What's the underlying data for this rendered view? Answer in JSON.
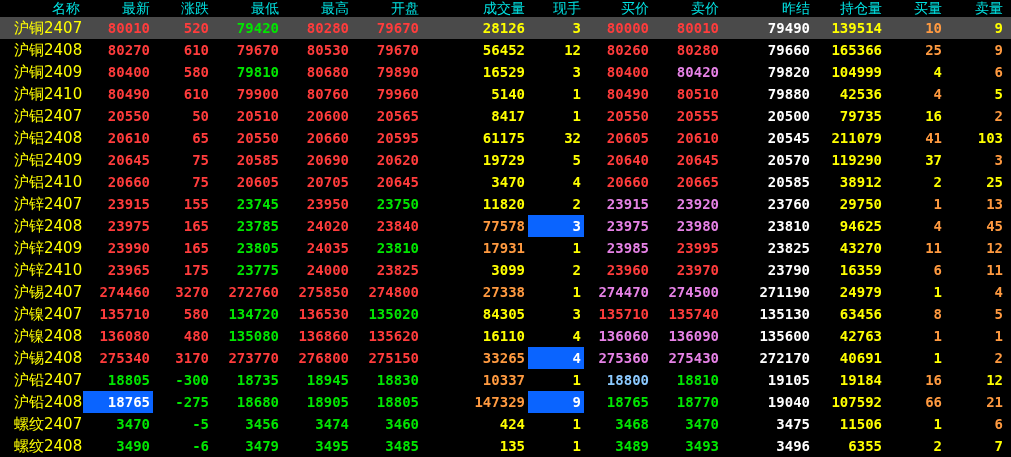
{
  "columns": [
    "名称",
    "最新",
    "涨跌",
    "最低",
    "最高",
    "开盘",
    "成交量",
    "现手",
    "买价",
    "卖价",
    "昨结",
    "持仓量",
    "买量",
    "卖量"
  ],
  "rows": [
    {
      "name": "沪铜2407",
      "selected": true,
      "cells": [
        {
          "text": "80010",
          "color": "#ff3c3c",
          "highlighted": false
        },
        {
          "text": "520",
          "color": "#ff3c3c",
          "highlighted": false
        },
        {
          "text": "79420",
          "color": "#00e600",
          "highlighted": false
        },
        {
          "text": "80280",
          "color": "#ff3c3c",
          "highlighted": false
        },
        {
          "text": "79670",
          "color": "#ff3c3c",
          "highlighted": false
        },
        {
          "text": "28126",
          "color": "#ffff00",
          "highlighted": false
        },
        {
          "text": "3",
          "color": "#ffff00",
          "highlighted": false
        },
        {
          "text": "80000",
          "color": "#ff3c3c",
          "highlighted": false
        },
        {
          "text": "80010",
          "color": "#ff3c3c",
          "highlighted": false
        },
        {
          "text": "79490",
          "color": "#ffffff",
          "highlighted": false
        },
        {
          "text": "139514",
          "color": "#ffff00",
          "highlighted": false
        },
        {
          "text": "10",
          "color": "#ff9a40",
          "highlighted": false
        },
        {
          "text": "9",
          "color": "#ffff00",
          "highlighted": false
        }
      ]
    },
    {
      "name": "沪铜2408",
      "selected": false,
      "cells": [
        {
          "text": "80270",
          "color": "#ff3c3c",
          "highlighted": false
        },
        {
          "text": "610",
          "color": "#ff3c3c",
          "highlighted": false
        },
        {
          "text": "79670",
          "color": "#ff3c3c",
          "highlighted": false
        },
        {
          "text": "80530",
          "color": "#ff3c3c",
          "highlighted": false
        },
        {
          "text": "79670",
          "color": "#ff3c3c",
          "highlighted": false
        },
        {
          "text": "56452",
          "color": "#ffff00",
          "highlighted": false
        },
        {
          "text": "12",
          "color": "#ffff00",
          "highlighted": false
        },
        {
          "text": "80260",
          "color": "#ff3c3c",
          "highlighted": false
        },
        {
          "text": "80280",
          "color": "#ff3c3c",
          "highlighted": false
        },
        {
          "text": "79660",
          "color": "#ffffff",
          "highlighted": false
        },
        {
          "text": "165366",
          "color": "#ffff00",
          "highlighted": false
        },
        {
          "text": "25",
          "color": "#ff9a40",
          "highlighted": false
        },
        {
          "text": "9",
          "color": "#ff9a40",
          "highlighted": false
        }
      ]
    },
    {
      "name": "沪铜2409",
      "selected": false,
      "cells": [
        {
          "text": "80400",
          "color": "#ff3c3c",
          "highlighted": false
        },
        {
          "text": "580",
          "color": "#ff3c3c",
          "highlighted": false
        },
        {
          "text": "79810",
          "color": "#00e600",
          "highlighted": false
        },
        {
          "text": "80680",
          "color": "#ff3c3c",
          "highlighted": false
        },
        {
          "text": "79890",
          "color": "#ff3c3c",
          "highlighted": false
        },
        {
          "text": "16529",
          "color": "#ffff00",
          "highlighted": false
        },
        {
          "text": "3",
          "color": "#ffff00",
          "highlighted": false
        },
        {
          "text": "80400",
          "color": "#ff3c3c",
          "highlighted": false
        },
        {
          "text": "80420",
          "color": "#e682e6",
          "highlighted": false
        },
        {
          "text": "79820",
          "color": "#ffffff",
          "highlighted": false
        },
        {
          "text": "104999",
          "color": "#ffff00",
          "highlighted": false
        },
        {
          "text": "4",
          "color": "#ffff00",
          "highlighted": false
        },
        {
          "text": "6",
          "color": "#ff9a40",
          "highlighted": false
        }
      ]
    },
    {
      "name": "沪铜2410",
      "selected": false,
      "cells": [
        {
          "text": "80490",
          "color": "#ff3c3c",
          "highlighted": false
        },
        {
          "text": "610",
          "color": "#ff3c3c",
          "highlighted": false
        },
        {
          "text": "79900",
          "color": "#ff3c3c",
          "highlighted": false
        },
        {
          "text": "80760",
          "color": "#ff3c3c",
          "highlighted": false
        },
        {
          "text": "79960",
          "color": "#ff3c3c",
          "highlighted": false
        },
        {
          "text": "5140",
          "color": "#ffff00",
          "highlighted": false
        },
        {
          "text": "1",
          "color": "#ffff00",
          "highlighted": false
        },
        {
          "text": "80490",
          "color": "#ff3c3c",
          "highlighted": false
        },
        {
          "text": "80510",
          "color": "#ff3c3c",
          "highlighted": false
        },
        {
          "text": "79880",
          "color": "#ffffff",
          "highlighted": false
        },
        {
          "text": "42536",
          "color": "#ffff00",
          "highlighted": false
        },
        {
          "text": "4",
          "color": "#ff9a40",
          "highlighted": false
        },
        {
          "text": "5",
          "color": "#ffff00",
          "highlighted": false
        }
      ]
    },
    {
      "name": "沪铝2407",
      "selected": false,
      "cells": [
        {
          "text": "20550",
          "color": "#ff3c3c",
          "highlighted": false
        },
        {
          "text": "50",
          "color": "#ff3c3c",
          "highlighted": false
        },
        {
          "text": "20510",
          "color": "#ff3c3c",
          "highlighted": false
        },
        {
          "text": "20600",
          "color": "#ff3c3c",
          "highlighted": false
        },
        {
          "text": "20565",
          "color": "#ff3c3c",
          "highlighted": false
        },
        {
          "text": "8417",
          "color": "#ffff00",
          "highlighted": false
        },
        {
          "text": "1",
          "color": "#ffff00",
          "highlighted": false
        },
        {
          "text": "20550",
          "color": "#ff3c3c",
          "highlighted": false
        },
        {
          "text": "20555",
          "color": "#ff3c3c",
          "highlighted": false
        },
        {
          "text": "20500",
          "color": "#ffffff",
          "highlighted": false
        },
        {
          "text": "79735",
          "color": "#ffff00",
          "highlighted": false
        },
        {
          "text": "16",
          "color": "#ffff00",
          "highlighted": false
        },
        {
          "text": "2",
          "color": "#ff9a40",
          "highlighted": false
        }
      ]
    },
    {
      "name": "沪铝2408",
      "selected": false,
      "cells": [
        {
          "text": "20610",
          "color": "#ff3c3c",
          "highlighted": false
        },
        {
          "text": "65",
          "color": "#ff3c3c",
          "highlighted": false
        },
        {
          "text": "20550",
          "color": "#ff3c3c",
          "highlighted": false
        },
        {
          "text": "20660",
          "color": "#ff3c3c",
          "highlighted": false
        },
        {
          "text": "20595",
          "color": "#ff3c3c",
          "highlighted": false
        },
        {
          "text": "61175",
          "color": "#ffff00",
          "highlighted": false
        },
        {
          "text": "32",
          "color": "#ffff00",
          "highlighted": false
        },
        {
          "text": "20605",
          "color": "#ff3c3c",
          "highlighted": false
        },
        {
          "text": "20610",
          "color": "#ff3c3c",
          "highlighted": false
        },
        {
          "text": "20545",
          "color": "#ffffff",
          "highlighted": false
        },
        {
          "text": "211079",
          "color": "#ffff00",
          "highlighted": false
        },
        {
          "text": "41",
          "color": "#ff9a40",
          "highlighted": false
        },
        {
          "text": "103",
          "color": "#ffff00",
          "highlighted": false
        }
      ]
    },
    {
      "name": "沪铝2409",
      "selected": false,
      "cells": [
        {
          "text": "20645",
          "color": "#ff3c3c",
          "highlighted": false
        },
        {
          "text": "75",
          "color": "#ff3c3c",
          "highlighted": false
        },
        {
          "text": "20585",
          "color": "#ff3c3c",
          "highlighted": false
        },
        {
          "text": "20690",
          "color": "#ff3c3c",
          "highlighted": false
        },
        {
          "text": "20620",
          "color": "#ff3c3c",
          "highlighted": false
        },
        {
          "text": "19729",
          "color": "#ffff00",
          "highlighted": false
        },
        {
          "text": "5",
          "color": "#ffff00",
          "highlighted": false
        },
        {
          "text": "20640",
          "color": "#ff3c3c",
          "highlighted": false
        },
        {
          "text": "20645",
          "color": "#ff3c3c",
          "highlighted": false
        },
        {
          "text": "20570",
          "color": "#ffffff",
          "highlighted": false
        },
        {
          "text": "119290",
          "color": "#ffff00",
          "highlighted": false
        },
        {
          "text": "37",
          "color": "#ffff00",
          "highlighted": false
        },
        {
          "text": "3",
          "color": "#ff9a40",
          "highlighted": false
        }
      ]
    },
    {
      "name": "沪铝2410",
      "selected": false,
      "cells": [
        {
          "text": "20660",
          "color": "#ff3c3c",
          "highlighted": false
        },
        {
          "text": "75",
          "color": "#ff3c3c",
          "highlighted": false
        },
        {
          "text": "20605",
          "color": "#ff3c3c",
          "highlighted": false
        },
        {
          "text": "20705",
          "color": "#ff3c3c",
          "highlighted": false
        },
        {
          "text": "20645",
          "color": "#ff3c3c",
          "highlighted": false
        },
        {
          "text": "3470",
          "color": "#ffff00",
          "highlighted": false
        },
        {
          "text": "4",
          "color": "#ffff00",
          "highlighted": false
        },
        {
          "text": "20660",
          "color": "#ff3c3c",
          "highlighted": false
        },
        {
          "text": "20665",
          "color": "#ff3c3c",
          "highlighted": false
        },
        {
          "text": "20585",
          "color": "#ffffff",
          "highlighted": false
        },
        {
          "text": "38912",
          "color": "#ffff00",
          "highlighted": false
        },
        {
          "text": "2",
          "color": "#ffff00",
          "highlighted": false
        },
        {
          "text": "25",
          "color": "#ffff00",
          "highlighted": false
        }
      ]
    },
    {
      "name": "沪锌2407",
      "selected": false,
      "cells": [
        {
          "text": "23915",
          "color": "#ff3c3c",
          "highlighted": false
        },
        {
          "text": "155",
          "color": "#ff3c3c",
          "highlighted": false
        },
        {
          "text": "23745",
          "color": "#00e600",
          "highlighted": false
        },
        {
          "text": "23950",
          "color": "#ff3c3c",
          "highlighted": false
        },
        {
          "text": "23750",
          "color": "#00e600",
          "highlighted": false
        },
        {
          "text": "11820",
          "color": "#ffff00",
          "highlighted": false
        },
        {
          "text": "2",
          "color": "#ffff00",
          "highlighted": false
        },
        {
          "text": "23915",
          "color": "#e682e6",
          "highlighted": false
        },
        {
          "text": "23920",
          "color": "#e682e6",
          "highlighted": false
        },
        {
          "text": "23760",
          "color": "#ffffff",
          "highlighted": false
        },
        {
          "text": "29750",
          "color": "#ffff00",
          "highlighted": false
        },
        {
          "text": "1",
          "color": "#ff9a40",
          "highlighted": false
        },
        {
          "text": "13",
          "color": "#ff9a40",
          "highlighted": false
        }
      ]
    },
    {
      "name": "沪锌2408",
      "selected": false,
      "cells": [
        {
          "text": "23975",
          "color": "#ff3c3c",
          "highlighted": false
        },
        {
          "text": "165",
          "color": "#ff3c3c",
          "highlighted": false
        },
        {
          "text": "23785",
          "color": "#00e600",
          "highlighted": false
        },
        {
          "text": "24020",
          "color": "#ff3c3c",
          "highlighted": false
        },
        {
          "text": "23840",
          "color": "#ff3c3c",
          "highlighted": false
        },
        {
          "text": "77578",
          "color": "#ff9a40",
          "highlighted": false
        },
        {
          "text": "3",
          "color": "#ffffff",
          "highlighted": true
        },
        {
          "text": "23975",
          "color": "#e682e6",
          "highlighted": false
        },
        {
          "text": "23980",
          "color": "#e682e6",
          "highlighted": false
        },
        {
          "text": "23810",
          "color": "#ffffff",
          "highlighted": false
        },
        {
          "text": "94625",
          "color": "#ffff00",
          "highlighted": false
        },
        {
          "text": "4",
          "color": "#ff9a40",
          "highlighted": false
        },
        {
          "text": "45",
          "color": "#ff9a40",
          "highlighted": false
        }
      ]
    },
    {
      "name": "沪锌2409",
      "selected": false,
      "cells": [
        {
          "text": "23990",
          "color": "#ff3c3c",
          "highlighted": false
        },
        {
          "text": "165",
          "color": "#ff3c3c",
          "highlighted": false
        },
        {
          "text": "23805",
          "color": "#00e600",
          "highlighted": false
        },
        {
          "text": "24035",
          "color": "#ff3c3c",
          "highlighted": false
        },
        {
          "text": "23810",
          "color": "#00e600",
          "highlighted": false
        },
        {
          "text": "17931",
          "color": "#ff9a40",
          "highlighted": false
        },
        {
          "text": "1",
          "color": "#ffff00",
          "highlighted": false
        },
        {
          "text": "23985",
          "color": "#e682e6",
          "highlighted": false
        },
        {
          "text": "23995",
          "color": "#ff3c3c",
          "highlighted": false
        },
        {
          "text": "23825",
          "color": "#ffffff",
          "highlighted": false
        },
        {
          "text": "43270",
          "color": "#ffff00",
          "highlighted": false
        },
        {
          "text": "11",
          "color": "#ff9a40",
          "highlighted": false
        },
        {
          "text": "12",
          "color": "#ff9a40",
          "highlighted": false
        }
      ]
    },
    {
      "name": "沪锌2410",
      "selected": false,
      "cells": [
        {
          "text": "23965",
          "color": "#ff3c3c",
          "highlighted": false
        },
        {
          "text": "175",
          "color": "#ff3c3c",
          "highlighted": false
        },
        {
          "text": "23775",
          "color": "#00e600",
          "highlighted": false
        },
        {
          "text": "24000",
          "color": "#ff3c3c",
          "highlighted": false
        },
        {
          "text": "23825",
          "color": "#ff3c3c",
          "highlighted": false
        },
        {
          "text": "3099",
          "color": "#ffff00",
          "highlighted": false
        },
        {
          "text": "2",
          "color": "#ffff00",
          "highlighted": false
        },
        {
          "text": "23960",
          "color": "#ff3c3c",
          "highlighted": false
        },
        {
          "text": "23970",
          "color": "#ff3c3c",
          "highlighted": false
        },
        {
          "text": "23790",
          "color": "#ffffff",
          "highlighted": false
        },
        {
          "text": "16359",
          "color": "#ffff00",
          "highlighted": false
        },
        {
          "text": "6",
          "color": "#ff9a40",
          "highlighted": false
        },
        {
          "text": "11",
          "color": "#ff9a40",
          "highlighted": false
        }
      ]
    },
    {
      "name": "沪锡2407",
      "selected": false,
      "cells": [
        {
          "text": "274460",
          "color": "#ff3c3c",
          "highlighted": false
        },
        {
          "text": "3270",
          "color": "#ff3c3c",
          "highlighted": false
        },
        {
          "text": "272760",
          "color": "#ff3c3c",
          "highlighted": false
        },
        {
          "text": "275850",
          "color": "#ff3c3c",
          "highlighted": false
        },
        {
          "text": "274800",
          "color": "#ff3c3c",
          "highlighted": false
        },
        {
          "text": "27338",
          "color": "#ff9a40",
          "highlighted": false
        },
        {
          "text": "1",
          "color": "#ffff00",
          "highlighted": false
        },
        {
          "text": "274470",
          "color": "#e682e6",
          "highlighted": false
        },
        {
          "text": "274500",
          "color": "#e682e6",
          "highlighted": false
        },
        {
          "text": "271190",
          "color": "#ffffff",
          "highlighted": false
        },
        {
          "text": "24979",
          "color": "#ffff00",
          "highlighted": false
        },
        {
          "text": "1",
          "color": "#ffff00",
          "highlighted": false
        },
        {
          "text": "4",
          "color": "#ff9a40",
          "highlighted": false
        }
      ]
    },
    {
      "name": "沪镍2407",
      "selected": false,
      "cells": [
        {
          "text": "135710",
          "color": "#ff3c3c",
          "highlighted": false
        },
        {
          "text": "580",
          "color": "#ff3c3c",
          "highlighted": false
        },
        {
          "text": "134720",
          "color": "#00e600",
          "highlighted": false
        },
        {
          "text": "136530",
          "color": "#ff3c3c",
          "highlighted": false
        },
        {
          "text": "135020",
          "color": "#00e600",
          "highlighted": false
        },
        {
          "text": "84305",
          "color": "#ffff00",
          "highlighted": false
        },
        {
          "text": "3",
          "color": "#ffff00",
          "highlighted": false
        },
        {
          "text": "135710",
          "color": "#ff3c3c",
          "highlighted": false
        },
        {
          "text": "135740",
          "color": "#ff3c3c",
          "highlighted": false
        },
        {
          "text": "135130",
          "color": "#ffffff",
          "highlighted": false
        },
        {
          "text": "63456",
          "color": "#ffff00",
          "highlighted": false
        },
        {
          "text": "8",
          "color": "#ff9a40",
          "highlighted": false
        },
        {
          "text": "5",
          "color": "#ff9a40",
          "highlighted": false
        }
      ]
    },
    {
      "name": "沪镍2408",
      "selected": false,
      "cells": [
        {
          "text": "136080",
          "color": "#ff3c3c",
          "highlighted": false
        },
        {
          "text": "480",
          "color": "#ff3c3c",
          "highlighted": false
        },
        {
          "text": "135080",
          "color": "#00e600",
          "highlighted": false
        },
        {
          "text": "136860",
          "color": "#ff3c3c",
          "highlighted": false
        },
        {
          "text": "135620",
          "color": "#ff3c3c",
          "highlighted": false
        },
        {
          "text": "16110",
          "color": "#ffff00",
          "highlighted": false
        },
        {
          "text": "4",
          "color": "#ffff00",
          "highlighted": false
        },
        {
          "text": "136060",
          "color": "#e682e6",
          "highlighted": false
        },
        {
          "text": "136090",
          "color": "#e682e6",
          "highlighted": false
        },
        {
          "text": "135600",
          "color": "#ffffff",
          "highlighted": false
        },
        {
          "text": "42763",
          "color": "#ffff00",
          "highlighted": false
        },
        {
          "text": "1",
          "color": "#ff9a40",
          "highlighted": false
        },
        {
          "text": "1",
          "color": "#ff9a40",
          "highlighted": false
        }
      ]
    },
    {
      "name": "沪锡2408",
      "selected": false,
      "cells": [
        {
          "text": "275340",
          "color": "#ff3c3c",
          "highlighted": false
        },
        {
          "text": "3170",
          "color": "#ff3c3c",
          "highlighted": false
        },
        {
          "text": "273770",
          "color": "#ff3c3c",
          "highlighted": false
        },
        {
          "text": "276800",
          "color": "#ff3c3c",
          "highlighted": false
        },
        {
          "text": "275150",
          "color": "#ff3c3c",
          "highlighted": false
        },
        {
          "text": "33265",
          "color": "#ff9a40",
          "highlighted": false
        },
        {
          "text": "4",
          "color": "#ffffff",
          "highlighted": true
        },
        {
          "text": "275360",
          "color": "#e682e6",
          "highlighted": false
        },
        {
          "text": "275430",
          "color": "#e682e6",
          "highlighted": false
        },
        {
          "text": "272170",
          "color": "#ffffff",
          "highlighted": false
        },
        {
          "text": "40691",
          "color": "#ffff00",
          "highlighted": false
        },
        {
          "text": "1",
          "color": "#ffff00",
          "highlighted": false
        },
        {
          "text": "2",
          "color": "#ff9a40",
          "highlighted": false
        }
      ]
    },
    {
      "name": "沪铅2407",
      "selected": false,
      "cells": [
        {
          "text": "18805",
          "color": "#00e600",
          "highlighted": false
        },
        {
          "text": "-300",
          "color": "#00e600",
          "highlighted": false
        },
        {
          "text": "18735",
          "color": "#00e600",
          "highlighted": false
        },
        {
          "text": "18945",
          "color": "#00e600",
          "highlighted": false
        },
        {
          "text": "18830",
          "color": "#00e600",
          "highlighted": false
        },
        {
          "text": "10337",
          "color": "#ff9a40",
          "highlighted": false
        },
        {
          "text": "1",
          "color": "#ffff00",
          "highlighted": false
        },
        {
          "text": "18800",
          "color": "#8ccaff",
          "highlighted": false
        },
        {
          "text": "18810",
          "color": "#00e600",
          "highlighted": false
        },
        {
          "text": "19105",
          "color": "#ffffff",
          "highlighted": false
        },
        {
          "text": "19184",
          "color": "#ffff00",
          "highlighted": false
        },
        {
          "text": "16",
          "color": "#ff9a40",
          "highlighted": false
        },
        {
          "text": "12",
          "color": "#ffff00",
          "highlighted": false
        }
      ]
    },
    {
      "name": "沪铅2408",
      "selected": false,
      "cells": [
        {
          "text": "18765",
          "color": "#ffffff",
          "highlighted": true
        },
        {
          "text": "-275",
          "color": "#00e600",
          "highlighted": false
        },
        {
          "text": "18680",
          "color": "#00e600",
          "highlighted": false
        },
        {
          "text": "18905",
          "color": "#00e600",
          "highlighted": false
        },
        {
          "text": "18805",
          "color": "#00e600",
          "highlighted": false
        },
        {
          "text": "147329",
          "color": "#ff9a40",
          "highlighted": false
        },
        {
          "text": "9",
          "color": "#ffffff",
          "highlighted": true
        },
        {
          "text": "18765",
          "color": "#00e600",
          "highlighted": false
        },
        {
          "text": "18770",
          "color": "#00e600",
          "highlighted": false
        },
        {
          "text": "19040",
          "color": "#ffffff",
          "highlighted": false
        },
        {
          "text": "107592",
          "color": "#ffff00",
          "highlighted": false
        },
        {
          "text": "66",
          "color": "#ff9a40",
          "highlighted": false
        },
        {
          "text": "21",
          "color": "#ff9a40",
          "highlighted": false
        }
      ]
    },
    {
      "name": "螺纹2407",
      "selected": false,
      "cells": [
        {
          "text": "3470",
          "color": "#00e600",
          "highlighted": false
        },
        {
          "text": "-5",
          "color": "#00e600",
          "highlighted": false
        },
        {
          "text": "3456",
          "color": "#00e600",
          "highlighted": false
        },
        {
          "text": "3474",
          "color": "#00e600",
          "highlighted": false
        },
        {
          "text": "3460",
          "color": "#00e600",
          "highlighted": false
        },
        {
          "text": "424",
          "color": "#ffff00",
          "highlighted": false
        },
        {
          "text": "1",
          "color": "#ffff00",
          "highlighted": false
        },
        {
          "text": "3468",
          "color": "#00e600",
          "highlighted": false
        },
        {
          "text": "3470",
          "color": "#00e600",
          "highlighted": false
        },
        {
          "text": "3475",
          "color": "#ffffff",
          "highlighted": false
        },
        {
          "text": "11506",
          "color": "#ffff00",
          "highlighted": false
        },
        {
          "text": "1",
          "color": "#ffff00",
          "highlighted": false
        },
        {
          "text": "6",
          "color": "#ff9a40",
          "highlighted": false
        }
      ]
    },
    {
      "name": "螺纹2408",
      "selected": false,
      "cells": [
        {
          "text": "3490",
          "color": "#00e600",
          "highlighted": false
        },
        {
          "text": "-6",
          "color": "#00e600",
          "highlighted": false
        },
        {
          "text": "3479",
          "color": "#00e600",
          "highlighted": false
        },
        {
          "text": "3495",
          "color": "#00e600",
          "highlighted": false
        },
        {
          "text": "3485",
          "color": "#00e600",
          "highlighted": false
        },
        {
          "text": "135",
          "color": "#ffff00",
          "highlighted": false
        },
        {
          "text": "1",
          "color": "#ffff00",
          "highlighted": false
        },
        {
          "text": "3489",
          "color": "#00e600",
          "highlighted": false
        },
        {
          "text": "3493",
          "color": "#00e600",
          "highlighted": false
        },
        {
          "text": "3496",
          "color": "#ffffff",
          "highlighted": false
        },
        {
          "text": "6355",
          "color": "#ffff00",
          "highlighted": false
        },
        {
          "text": "2",
          "color": "#ffff00",
          "highlighted": false
        },
        {
          "text": "7",
          "color": "#ffff00",
          "highlighted": false
        }
      ]
    }
  ]
}
